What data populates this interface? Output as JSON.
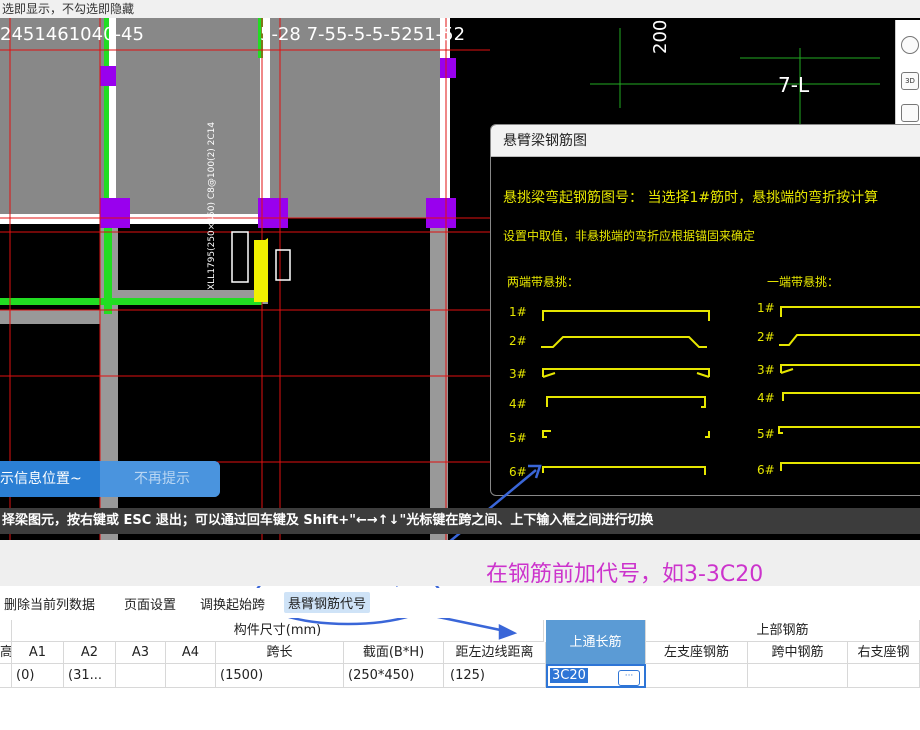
{
  "top_hint": "选即显示，不勾选即隐藏",
  "cad": {
    "labels": {
      "top_left_overlap": "2451461040-45",
      "top_mid_overlap": "5-28 7-55-5-5-5251-52",
      "dim_200": "200",
      "axis_7L": "7-L",
      "vertical_note": "XLL1795(250×450) C8@100(2) 2C14"
    }
  },
  "side_toolbar": {
    "btn_3d": "3D"
  },
  "popup": {
    "title": "悬臂梁钢筋图",
    "line1": "悬挑梁弯起钢筋图号： 当选择1#筋时，悬挑端的弯折按计算",
    "line2": "设置中取值，非悬挑端的弯折应根据锚固来确定",
    "left_heading": "两端带悬挑：",
    "right_heading": "一端带悬挑：",
    "left_labels": [
      "1#",
      "2#",
      "3#",
      "4#",
      "5#",
      "6#"
    ],
    "right_labels": [
      "1#",
      "2#",
      "3#",
      "4#",
      "5#",
      "6#"
    ]
  },
  "tip": {
    "position_text": "示信息位置~",
    "dismiss": "不再提示"
  },
  "status_bar": "择梁图元，按右键或 ESC 退出；可以通过回车键及 Shift+\"←→↑↓\"光标键在跨之间、上下输入框之间进行切换",
  "annotation": "在钢筋前加代号，如3-3C20",
  "toolbar": {
    "delete_col": "删除当前列数据",
    "page_setup": "页面设置",
    "swap_start": "调换起始跨",
    "cantilever_code": "悬臂钢筋代号"
  },
  "table": {
    "group_size": "构件尺寸(mm)",
    "group_top": "上部钢筋",
    "headers": [
      "高",
      "A1",
      "A2",
      "A3",
      "A4",
      "跨长",
      "截面(B*H)",
      "距左边线距离",
      "上通长筋",
      "左支座钢筋",
      "跨中钢筋",
      "右支座钢"
    ],
    "row": [
      "",
      "(0)",
      "(31...",
      "",
      "",
      "(1500)",
      "(250*450)",
      "(125)",
      "3C20",
      "",
      "",
      ""
    ],
    "ellipsis": "···"
  },
  "colors": {
    "accent": "#2e75d6",
    "annotation": "#cc33cc",
    "cad_yellow": "#e6e600",
    "cad_green": "#22dd22",
    "cad_red": "#e01010"
  }
}
